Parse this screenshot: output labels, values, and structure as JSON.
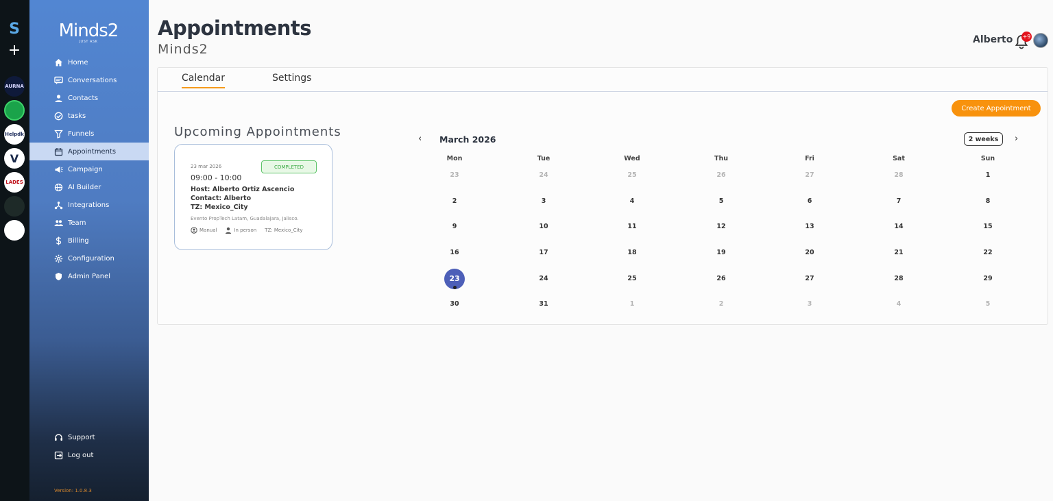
{
  "rail": {
    "brand_glyph": "S",
    "add_glyph": "+",
    "workspaces": [
      {
        "label": "AURNA",
        "bg": "#0f1a3a",
        "fg": "#d8d8ff"
      },
      {
        "label": "",
        "bg": "#1aa34a",
        "fg": "#fff"
      },
      {
        "label": "Helpdk",
        "bg": "#ffffff",
        "fg": "#1a2a5a"
      },
      {
        "label": "V",
        "bg": "#ffffff",
        "fg": "#1a2a4a"
      },
      {
        "label": "LADES",
        "bg": "#ffffff",
        "fg": "#c0101a"
      },
      {
        "label": "",
        "bg": "#1e2a28",
        "fg": "#9c9"
      },
      {
        "label": "",
        "bg": "#ffffff",
        "fg": "#333"
      }
    ]
  },
  "sidebar": {
    "logo": {
      "wordmark": "Minds2",
      "tagline": "JUST ASK"
    },
    "items": [
      {
        "label": "Home",
        "icon": "home-icon",
        "active": false
      },
      {
        "label": "Conversations",
        "icon": "chat-icon",
        "active": false
      },
      {
        "label": "Contacts",
        "icon": "person-icon",
        "active": false
      },
      {
        "label": "tasks",
        "icon": "check-circle-icon",
        "active": false
      },
      {
        "label": "Funnels",
        "icon": "filter-icon",
        "active": false
      },
      {
        "label": "Appointments",
        "icon": "calendar-icon",
        "active": true
      },
      {
        "label": "Campaign",
        "icon": "megaphone-icon",
        "active": false
      },
      {
        "label": "AI Builder",
        "icon": "globe-icon",
        "active": false
      },
      {
        "label": "Integrations",
        "icon": "network-icon",
        "active": false
      },
      {
        "label": "Team",
        "icon": "team-icon",
        "active": false
      },
      {
        "label": "Billing",
        "icon": "dollar-icon",
        "active": false
      },
      {
        "label": "Configuration",
        "icon": "gear-icon",
        "active": false
      },
      {
        "label": "Admin Panel",
        "icon": "admin-icon",
        "active": false
      }
    ],
    "bottom": [
      {
        "label": "Support",
        "icon": "headset-icon"
      },
      {
        "label": "Log out",
        "icon": "logout-icon"
      }
    ],
    "version": "Version: 1.0.8.3"
  },
  "header": {
    "title": "Appointments",
    "subtitle": "Minds2",
    "user_name": "Alberto",
    "notification_count": "+9"
  },
  "tabs": [
    {
      "label": "Calendar",
      "active": true
    },
    {
      "label": "Settings",
      "active": false
    }
  ],
  "create_button": "Create Appointment",
  "upcoming": {
    "title": "Upcoming Appointments",
    "appointment": {
      "date": "23 mar 2026",
      "status": "COMPLETED",
      "time": "09:00 - 10:00",
      "host": "Host: Alberto Ortiz Ascencio",
      "contact": "Contact: Alberto",
      "tz": "TZ: Mexico_City",
      "location": "Evento PropTech Latam, Guadalajara, Jalisco.",
      "meta": {
        "source": "Manual",
        "mode": "In person",
        "tz": "TZ: Mexico_City"
      }
    }
  },
  "calendar": {
    "month": "March 2026",
    "range": "2 weeks",
    "prev_glyph": "‹",
    "next_glyph": "›",
    "weekdays": [
      "Mon",
      "Tue",
      "Wed",
      "Thu",
      "Fri",
      "Sat",
      "Sun"
    ],
    "weeks": [
      [
        {
          "d": "23",
          "m": true
        },
        {
          "d": "24",
          "m": true
        },
        {
          "d": "25",
          "m": true
        },
        {
          "d": "26",
          "m": true
        },
        {
          "d": "27",
          "m": true
        },
        {
          "d": "28",
          "m": true
        },
        {
          "d": "1",
          "m": false
        }
      ],
      [
        {
          "d": "2",
          "m": false
        },
        {
          "d": "3",
          "m": false
        },
        {
          "d": "4",
          "m": false
        },
        {
          "d": "5",
          "m": false
        },
        {
          "d": "6",
          "m": false
        },
        {
          "d": "7",
          "m": false
        },
        {
          "d": "8",
          "m": false
        }
      ],
      [
        {
          "d": "9",
          "m": false
        },
        {
          "d": "10",
          "m": false
        },
        {
          "d": "11",
          "m": false
        },
        {
          "d": "12",
          "m": false
        },
        {
          "d": "13",
          "m": false
        },
        {
          "d": "14",
          "m": false
        },
        {
          "d": "15",
          "m": false
        }
      ],
      [
        {
          "d": "16",
          "m": false
        },
        {
          "d": "17",
          "m": false
        },
        {
          "d": "18",
          "m": false
        },
        {
          "d": "19",
          "m": false
        },
        {
          "d": "20",
          "m": false
        },
        {
          "d": "21",
          "m": false
        },
        {
          "d": "22",
          "m": false
        }
      ],
      [
        {
          "d": "23",
          "m": false,
          "today": true,
          "event": true
        },
        {
          "d": "24",
          "m": false
        },
        {
          "d": "25",
          "m": false
        },
        {
          "d": "26",
          "m": false
        },
        {
          "d": "27",
          "m": false
        },
        {
          "d": "28",
          "m": false
        },
        {
          "d": "29",
          "m": false
        }
      ],
      [
        {
          "d": "30",
          "m": false
        },
        {
          "d": "31",
          "m": false
        },
        {
          "d": "1",
          "m": true
        },
        {
          "d": "2",
          "m": true
        },
        {
          "d": "3",
          "m": true
        },
        {
          "d": "4",
          "m": true
        },
        {
          "d": "5",
          "m": true
        }
      ]
    ]
  }
}
